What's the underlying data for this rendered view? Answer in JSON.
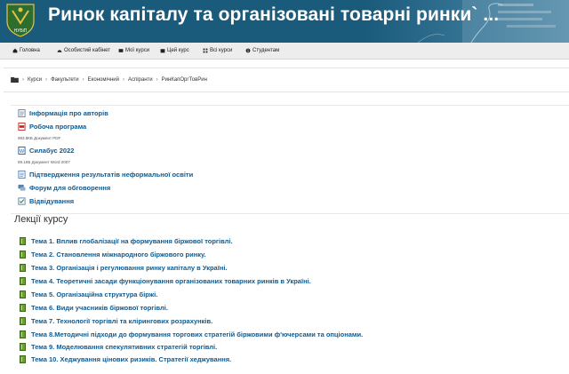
{
  "header": {
    "title": "Ринок капіталу та організовані товарні ринки` ...",
    "logo_text": "НУБіП",
    "colors": {
      "header_bg": "#1a5a7a",
      "link": "#0f5a8f",
      "book_green": "#6b9f2f"
    }
  },
  "nav": {
    "items": [
      {
        "label": "Головна",
        "icon": "home-icon"
      },
      {
        "label": "Особистий кабінет",
        "icon": "dashboard-icon"
      },
      {
        "label": "Мої курси",
        "icon": "courses-icon"
      },
      {
        "label": "Цей курс",
        "icon": "course-icon"
      },
      {
        "label": "Всі курси",
        "icon": "grid-icon"
      },
      {
        "label": "Студентам",
        "icon": "info-icon"
      }
    ]
  },
  "breadcrumb": {
    "items": [
      "Курси",
      "Факультети",
      "Економічний",
      "Аспіранти",
      "РинКапОргТовРин"
    ]
  },
  "resources": {
    "items": [
      {
        "label": "Інформація про авторів",
        "icon": "page-icon"
      },
      {
        "label": "Робоча програма",
        "icon": "pdf-icon",
        "meta": "993.8КБ Документ PDF"
      },
      {
        "label": "Силабус 2022",
        "icon": "word-icon",
        "meta": "59.1КБ Документ Word 2007"
      },
      {
        "label": "Підтвердження результатів неформальної освіти",
        "icon": "page-icon"
      },
      {
        "label": "Форум для обговорення",
        "icon": "forum-icon"
      },
      {
        "label": "Відвідування",
        "icon": "attendance-icon"
      }
    ]
  },
  "lectures": {
    "title": "Лекції курсу",
    "items": [
      "Тема 1. Вплив глобалізації на формування біржової торгівлі.",
      "Тема 2. Становлення міжнародного біржового ринку.",
      "Тема 3. Організація і регулювання ринку капіталу в Україні.",
      "Тема 4. Теоретичні засади функціонування організованих товарних ринків в Україні.",
      "Тема 5. Організаційна структура біржі.",
      "Тема 6. Види учасників біржової торгівлі.",
      "Тема 7. Технології торгівлі та клірингових розрахунків.",
      "Тема 8.Методичні підходи до формування торгових стратегій біржовими ф'ючерсами та опціонами.",
      "Тема 9. Моделювання спекулятивних стратегій торгівлі.",
      "Тема 10. Хеджування цінових ризиків. Стратегії хеджування."
    ]
  }
}
